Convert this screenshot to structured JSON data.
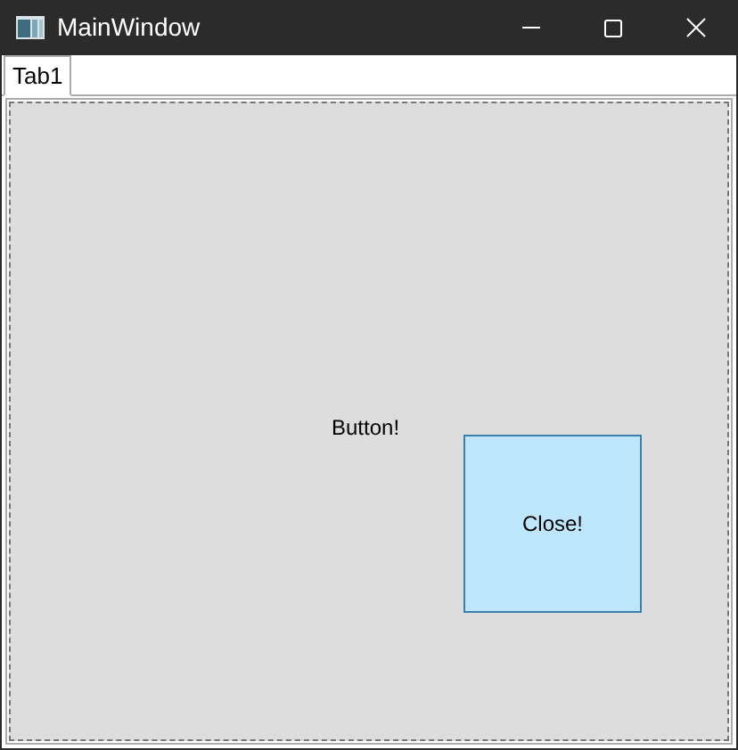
{
  "window": {
    "title": "MainWindow"
  },
  "tabs": [
    {
      "label": "Tab1",
      "selected": true
    }
  ],
  "content": {
    "label": "Button!",
    "button": "Close!"
  }
}
